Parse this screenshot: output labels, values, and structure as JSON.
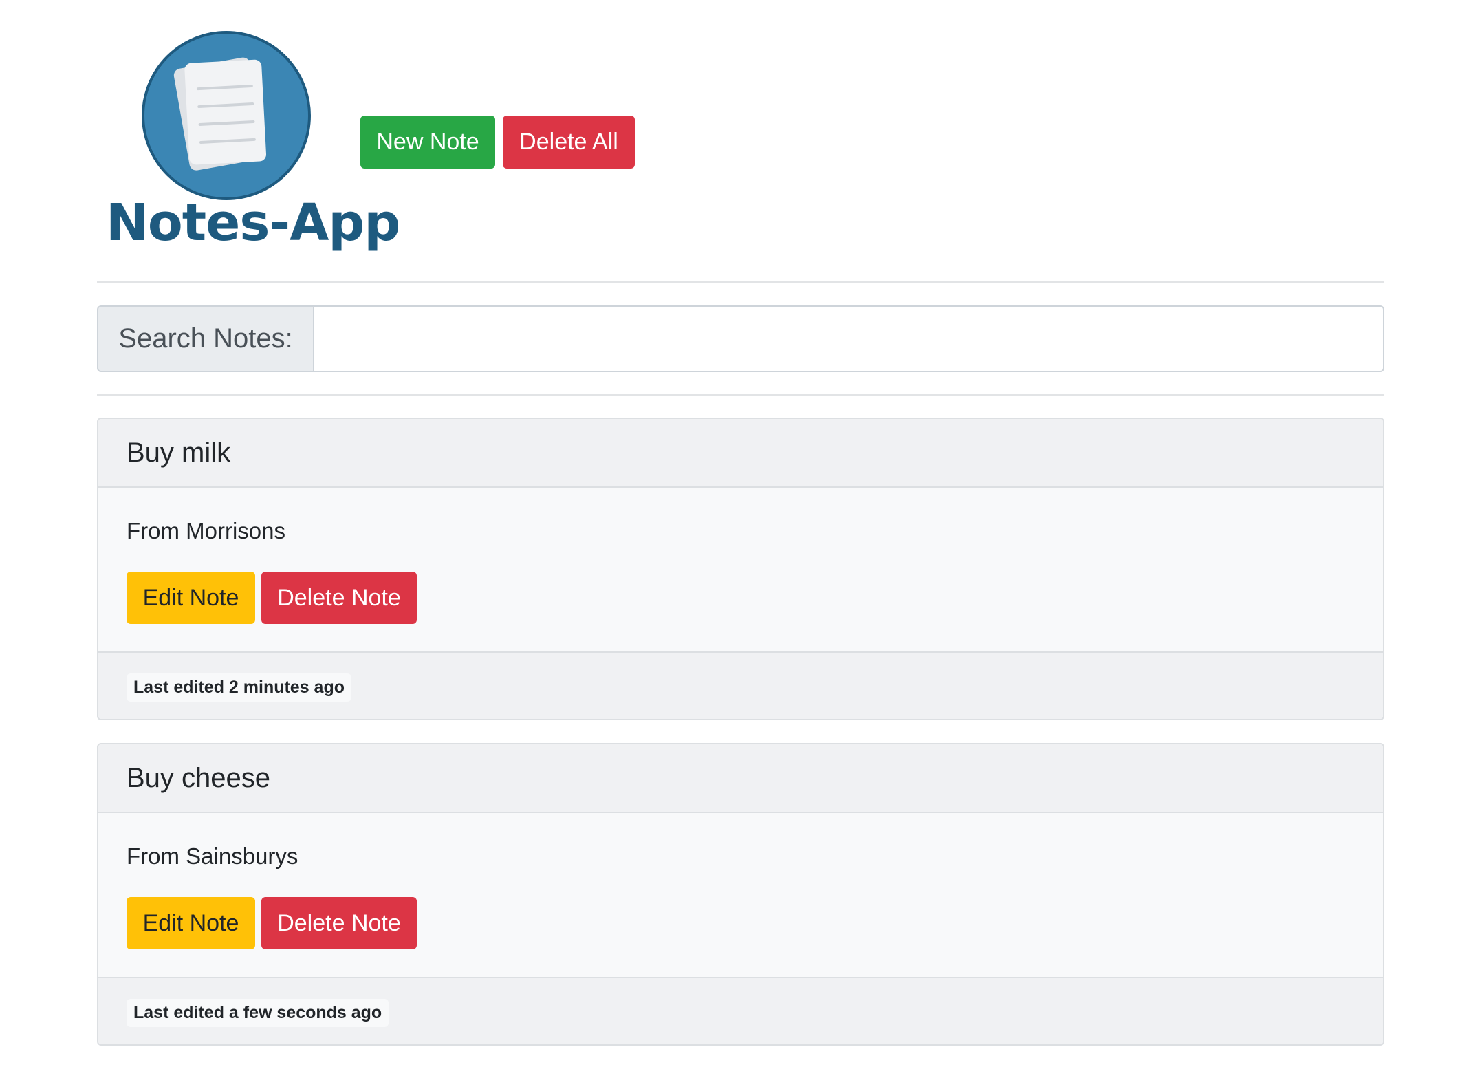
{
  "app": {
    "logo_text": "Notes-App"
  },
  "toolbar": {
    "new_note_label": "New Note",
    "delete_all_label": "Delete All"
  },
  "search": {
    "label": "Search Notes:",
    "value": "",
    "placeholder": ""
  },
  "notes": [
    {
      "title": "Buy milk",
      "body": "From Morrisons",
      "edit_label": "Edit Note",
      "delete_label": "Delete Note",
      "last_edited": "Last edited 2 minutes ago"
    },
    {
      "title": "Buy cheese",
      "body": "From Sainsburys",
      "edit_label": "Edit Note",
      "delete_label": "Delete Note",
      "last_edited": "Last edited a few seconds ago"
    }
  ],
  "colors": {
    "success": "#28a745",
    "danger": "#dc3545",
    "warning": "#ffc107",
    "logo_blue": "#3b86b4",
    "logo_dark": "#1e5a7f"
  },
  "icons": {
    "logo": "notes-document-icon"
  }
}
